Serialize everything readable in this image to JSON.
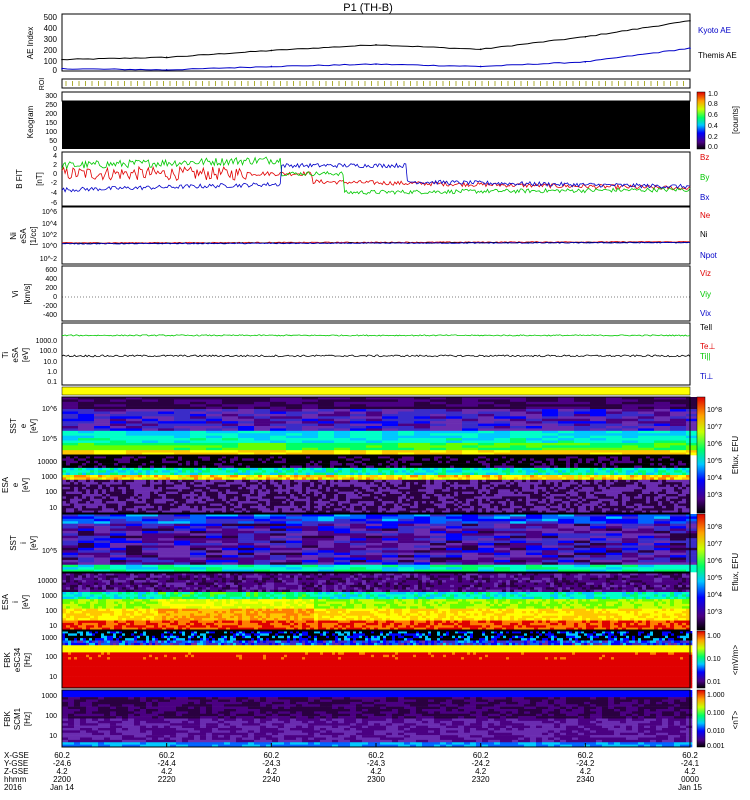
{
  "title": "P1 (TH-B)",
  "colors": {
    "black": "#000000",
    "blue": "#0000c8",
    "green": "#00c800",
    "red": "#e00000",
    "yellow": "#ffff00",
    "roi": "#9a9a00"
  },
  "panels": {
    "ae": {
      "ylabel": "AE Index",
      "ticks": [
        "500",
        "400",
        "300",
        "200",
        "100",
        "0"
      ],
      "legend": [
        "Kyoto AE",
        "Themis AE"
      ],
      "ylim": [
        0,
        500
      ]
    },
    "roi": {
      "ylabel": "ROI"
    },
    "keogram": {
      "ylabel": "Keogram",
      "ticks": [
        "300",
        "250",
        "200",
        "150",
        "100",
        "50",
        "0"
      ],
      "colorbar": {
        "title": "[counts]",
        "ticks": [
          "1.0",
          "0.8",
          "0.6",
          "0.4",
          "0.2",
          "0.0"
        ]
      }
    },
    "bfield": {
      "ylabel": "B FIT",
      "units": "[nT]",
      "ticks": [
        "4",
        "2",
        "0",
        "-2",
        "-4",
        "-6"
      ],
      "legend": [
        "Bz",
        "By",
        "Bx"
      ]
    },
    "density": {
      "ylabel": "Ni",
      "sublabel": "eSA",
      "units": "[1/cc]",
      "ticks": [
        "10^6",
        "10^4",
        "10^2",
        "10^0",
        "10^-2"
      ],
      "legend": [
        "Ne",
        "Ni",
        "Npot"
      ]
    },
    "velocity": {
      "ylabel": "Vi",
      "units": "[km/s]",
      "ticks": [
        "600",
        "400",
        "200",
        "0",
        "-200",
        "-400"
      ],
      "legend": [
        "Viz",
        "Viy",
        "Vix"
      ]
    },
    "temperature": {
      "ylabel": "Ti",
      "sublabel": "eSA",
      "units": "[eV]",
      "ticks": [
        "1000.0",
        "100.0",
        "10.0",
        "1.0",
        "0.1"
      ],
      "legend": [
        "Tell",
        "Te⊥",
        "Ti||",
        "Ti⊥"
      ]
    },
    "sst_e": {
      "ylabel": "SST",
      "sublabel": "e",
      "units": "[eV]",
      "ticks": [
        "10^6",
        "10^5"
      ]
    },
    "esa_e": {
      "ylabel": "ESA",
      "sublabel": "e",
      "units": "[eV]",
      "ticks": [
        "10000",
        "1000",
        "100",
        "10"
      ]
    },
    "sst_i": {
      "ylabel": "SST",
      "sublabel": "i",
      "units": "[eV]",
      "ticks": [
        "10^5"
      ]
    },
    "esa_i": {
      "ylabel": "ESA",
      "sublabel": "i",
      "units": "[eV]",
      "ticks": [
        "10000",
        "1000",
        "100",
        "10"
      ]
    },
    "fbk_e": {
      "ylabel": "FBK",
      "sublabel": "eSC34",
      "units": "[Hz]",
      "ticks": [
        "1000",
        "100",
        "10"
      ]
    },
    "fbk_b": {
      "ylabel": "FBK",
      "sublabel": "SCM1",
      "units": "[Hz]",
      "ticks": [
        "1000",
        "100",
        "10"
      ]
    }
  },
  "colorbars": {
    "eflux": {
      "title": "Eflux, EFU",
      "ticks": [
        "10^8",
        "10^7",
        "10^6",
        "10^5",
        "10^4",
        "10^3"
      ]
    },
    "fbk_e": {
      "title": "<mV/m>",
      "ticks": [
        "1.00",
        "0.10",
        "0.01"
      ]
    },
    "fbk_b": {
      "title": "<nT>",
      "ticks": [
        "1.000",
        "0.100",
        "0.010",
        "0.001"
      ]
    }
  },
  "xaxis": {
    "row_labels": [
      "X-GSE",
      "Y-GSE",
      "Z-GSE",
      "hhmm",
      "2016"
    ],
    "columns": [
      {
        "x": "60.2",
        "y": "-24.6",
        "z": "4.2",
        "t": "2200",
        "d": "Jan 14"
      },
      {
        "x": "60.2",
        "y": "-24.4",
        "z": "4.2",
        "t": "2220",
        "d": ""
      },
      {
        "x": "60.2",
        "y": "-24.3",
        "z": "4.2",
        "t": "2240",
        "d": ""
      },
      {
        "x": "60.2",
        "y": "-24.3",
        "z": "4.2",
        "t": "2300",
        "d": ""
      },
      {
        "x": "60.2",
        "y": "-24.2",
        "z": "4.2",
        "t": "2320",
        "d": ""
      },
      {
        "x": "60.2",
        "y": "-24.2",
        "z": "4.2",
        "t": "2340",
        "d": ""
      },
      {
        "x": "60.2",
        "y": "-24.1",
        "z": "4.2",
        "t": "0000",
        "d": "Jan 15"
      }
    ]
  },
  "chart_data": {
    "type": "line",
    "title": "P1 (TH-B)",
    "x": [
      "2200",
      "2220",
      "2240",
      "2300",
      "2320",
      "2340",
      "0000"
    ],
    "series": [
      {
        "name": "Kyoto AE",
        "values": [
          100,
          120,
          180,
          230,
          190,
          300,
          440
        ]
      },
      {
        "name": "Themis AE",
        "values": [
          20,
          10,
          40,
          60,
          40,
          80,
          200
        ]
      }
    ],
    "ylabel": "AE Index",
    "ylim": [
      0,
      500
    ]
  }
}
